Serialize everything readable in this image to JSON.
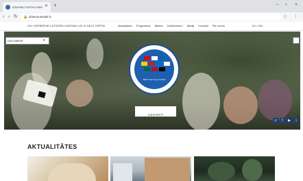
{
  "browser": {
    "tab_title": "DZIESMU SVĒTKU BIROJS",
    "tab_close_icon": "close-icon",
    "new_tab_label": "+",
    "url": "dziesmusvetki.lv",
    "window_controls": [
      "—",
      "□",
      "✕"
    ]
  },
  "site": {
    "tagline": "XXI VISPĀRĒJIE LATVIEŠU DZIESMU UN XI DEJU SVĒTKI",
    "nav": [
      "Aktualitātes",
      "Programma",
      "Biļetes",
      "Dalībniekiem",
      "Mediji",
      "Kontakti",
      "Par mums"
    ],
    "lang": {
      "current": "LV",
      "other": "EN"
    }
  },
  "hero": {
    "dropdown_label": "DOCUMENT",
    "cta_label": "UZZINĀT",
    "logo_ring_text": "Baltic Sea Song Festival",
    "social": [
      "v",
      "f",
      "▶",
      "i"
    ]
  },
  "news": {
    "title": "AKTUALITĀTES"
  },
  "colors": {
    "accent": "#1f5fb0",
    "logo_border": "#1a4f9c",
    "social_bg": "#1d3f70"
  }
}
